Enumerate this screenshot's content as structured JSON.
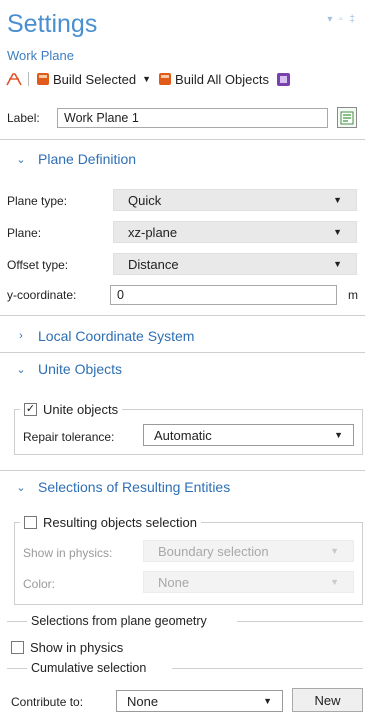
{
  "header": {
    "title": "Settings",
    "subtitle": "Work Plane",
    "window_controls": "▾ ▫ ‡"
  },
  "toolbar": {
    "build_selected_label": "Build Selected",
    "build_all_label": "Build All Objects"
  },
  "label_field": {
    "label": "Label:",
    "value": "Work Plane 1"
  },
  "plane_definition": {
    "heading": "Plane Definition",
    "plane_type": {
      "label": "Plane type:",
      "value": "Quick"
    },
    "plane": {
      "label": "Plane:",
      "value": "xz-plane"
    },
    "offset_type": {
      "label": "Offset type:",
      "value": "Distance"
    },
    "coordinate": {
      "label": "y-coordinate:",
      "value": "0",
      "unit": "m"
    }
  },
  "local_coordinate_system": {
    "heading": "Local Coordinate System"
  },
  "unite_objects": {
    "heading": "Unite Objects",
    "checkbox_label": "Unite objects",
    "checked": true,
    "repair_tolerance": {
      "label": "Repair tolerance:",
      "value": "Automatic"
    }
  },
  "selections": {
    "heading": "Selections of Resulting Entities",
    "resulting_objects": {
      "label": "Resulting objects selection",
      "checked": false
    },
    "show_in_physics": {
      "label": "Show in physics:",
      "value": "Boundary selection"
    },
    "color": {
      "label": "Color:",
      "value": "None"
    },
    "plane_geometry_group": "Selections from plane geometry",
    "plane_show_in_physics": {
      "label": "Show in physics",
      "checked": false
    },
    "cumulative_group": "Cumulative selection",
    "contribute_to": {
      "label": "Contribute to:",
      "value": "None"
    },
    "new_button": "New"
  },
  "colors": {
    "accent": "#2e6fb5",
    "title": "#4a8fd0",
    "build_icon": "#e05a1a",
    "graphics_icon": "#7b3fb0"
  },
  "icons": {
    "geometry": "work-plane-geometry-icon",
    "build_selected": "build-selected-icon",
    "build_all": "build-all-icon",
    "graphics": "graphics-icon",
    "label_edit": "label-edit-icon"
  }
}
